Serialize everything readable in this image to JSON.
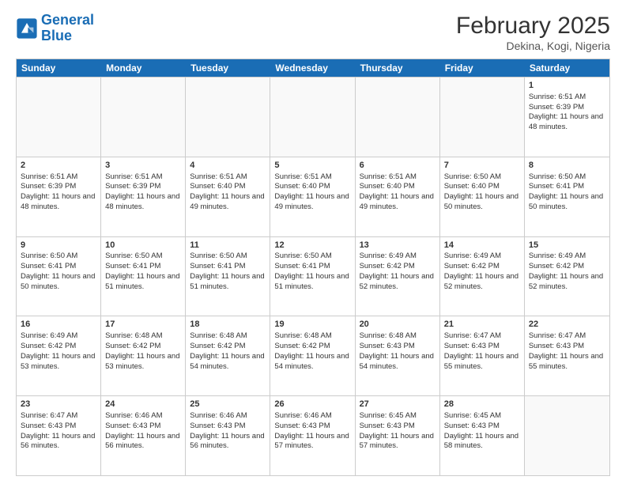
{
  "logo": {
    "line1": "General",
    "line2": "Blue"
  },
  "title": "February 2025",
  "subtitle": "Dekina, Kogi, Nigeria",
  "header": {
    "days": [
      "Sunday",
      "Monday",
      "Tuesday",
      "Wednesday",
      "Thursday",
      "Friday",
      "Saturday"
    ]
  },
  "weeks": [
    [
      {
        "day": "",
        "content": ""
      },
      {
        "day": "",
        "content": ""
      },
      {
        "day": "",
        "content": ""
      },
      {
        "day": "",
        "content": ""
      },
      {
        "day": "",
        "content": ""
      },
      {
        "day": "",
        "content": ""
      },
      {
        "day": "1",
        "content": "Sunrise: 6:51 AM\nSunset: 6:39 PM\nDaylight: 11 hours and 48 minutes."
      }
    ],
    [
      {
        "day": "2",
        "content": "Sunrise: 6:51 AM\nSunset: 6:39 PM\nDaylight: 11 hours and 48 minutes."
      },
      {
        "day": "3",
        "content": "Sunrise: 6:51 AM\nSunset: 6:39 PM\nDaylight: 11 hours and 48 minutes."
      },
      {
        "day": "4",
        "content": "Sunrise: 6:51 AM\nSunset: 6:40 PM\nDaylight: 11 hours and 49 minutes."
      },
      {
        "day": "5",
        "content": "Sunrise: 6:51 AM\nSunset: 6:40 PM\nDaylight: 11 hours and 49 minutes."
      },
      {
        "day": "6",
        "content": "Sunrise: 6:51 AM\nSunset: 6:40 PM\nDaylight: 11 hours and 49 minutes."
      },
      {
        "day": "7",
        "content": "Sunrise: 6:50 AM\nSunset: 6:40 PM\nDaylight: 11 hours and 50 minutes."
      },
      {
        "day": "8",
        "content": "Sunrise: 6:50 AM\nSunset: 6:41 PM\nDaylight: 11 hours and 50 minutes."
      }
    ],
    [
      {
        "day": "9",
        "content": "Sunrise: 6:50 AM\nSunset: 6:41 PM\nDaylight: 11 hours and 50 minutes."
      },
      {
        "day": "10",
        "content": "Sunrise: 6:50 AM\nSunset: 6:41 PM\nDaylight: 11 hours and 51 minutes."
      },
      {
        "day": "11",
        "content": "Sunrise: 6:50 AM\nSunset: 6:41 PM\nDaylight: 11 hours and 51 minutes."
      },
      {
        "day": "12",
        "content": "Sunrise: 6:50 AM\nSunset: 6:41 PM\nDaylight: 11 hours and 51 minutes."
      },
      {
        "day": "13",
        "content": "Sunrise: 6:49 AM\nSunset: 6:42 PM\nDaylight: 11 hours and 52 minutes."
      },
      {
        "day": "14",
        "content": "Sunrise: 6:49 AM\nSunset: 6:42 PM\nDaylight: 11 hours and 52 minutes."
      },
      {
        "day": "15",
        "content": "Sunrise: 6:49 AM\nSunset: 6:42 PM\nDaylight: 11 hours and 52 minutes."
      }
    ],
    [
      {
        "day": "16",
        "content": "Sunrise: 6:49 AM\nSunset: 6:42 PM\nDaylight: 11 hours and 53 minutes."
      },
      {
        "day": "17",
        "content": "Sunrise: 6:48 AM\nSunset: 6:42 PM\nDaylight: 11 hours and 53 minutes."
      },
      {
        "day": "18",
        "content": "Sunrise: 6:48 AM\nSunset: 6:42 PM\nDaylight: 11 hours and 54 minutes."
      },
      {
        "day": "19",
        "content": "Sunrise: 6:48 AM\nSunset: 6:42 PM\nDaylight: 11 hours and 54 minutes."
      },
      {
        "day": "20",
        "content": "Sunrise: 6:48 AM\nSunset: 6:43 PM\nDaylight: 11 hours and 54 minutes."
      },
      {
        "day": "21",
        "content": "Sunrise: 6:47 AM\nSunset: 6:43 PM\nDaylight: 11 hours and 55 minutes."
      },
      {
        "day": "22",
        "content": "Sunrise: 6:47 AM\nSunset: 6:43 PM\nDaylight: 11 hours and 55 minutes."
      }
    ],
    [
      {
        "day": "23",
        "content": "Sunrise: 6:47 AM\nSunset: 6:43 PM\nDaylight: 11 hours and 56 minutes."
      },
      {
        "day": "24",
        "content": "Sunrise: 6:46 AM\nSunset: 6:43 PM\nDaylight: 11 hours and 56 minutes."
      },
      {
        "day": "25",
        "content": "Sunrise: 6:46 AM\nSunset: 6:43 PM\nDaylight: 11 hours and 56 minutes."
      },
      {
        "day": "26",
        "content": "Sunrise: 6:46 AM\nSunset: 6:43 PM\nDaylight: 11 hours and 57 minutes."
      },
      {
        "day": "27",
        "content": "Sunrise: 6:45 AM\nSunset: 6:43 PM\nDaylight: 11 hours and 57 minutes."
      },
      {
        "day": "28",
        "content": "Sunrise: 6:45 AM\nSunset: 6:43 PM\nDaylight: 11 hours and 58 minutes."
      },
      {
        "day": "",
        "content": ""
      }
    ]
  ]
}
